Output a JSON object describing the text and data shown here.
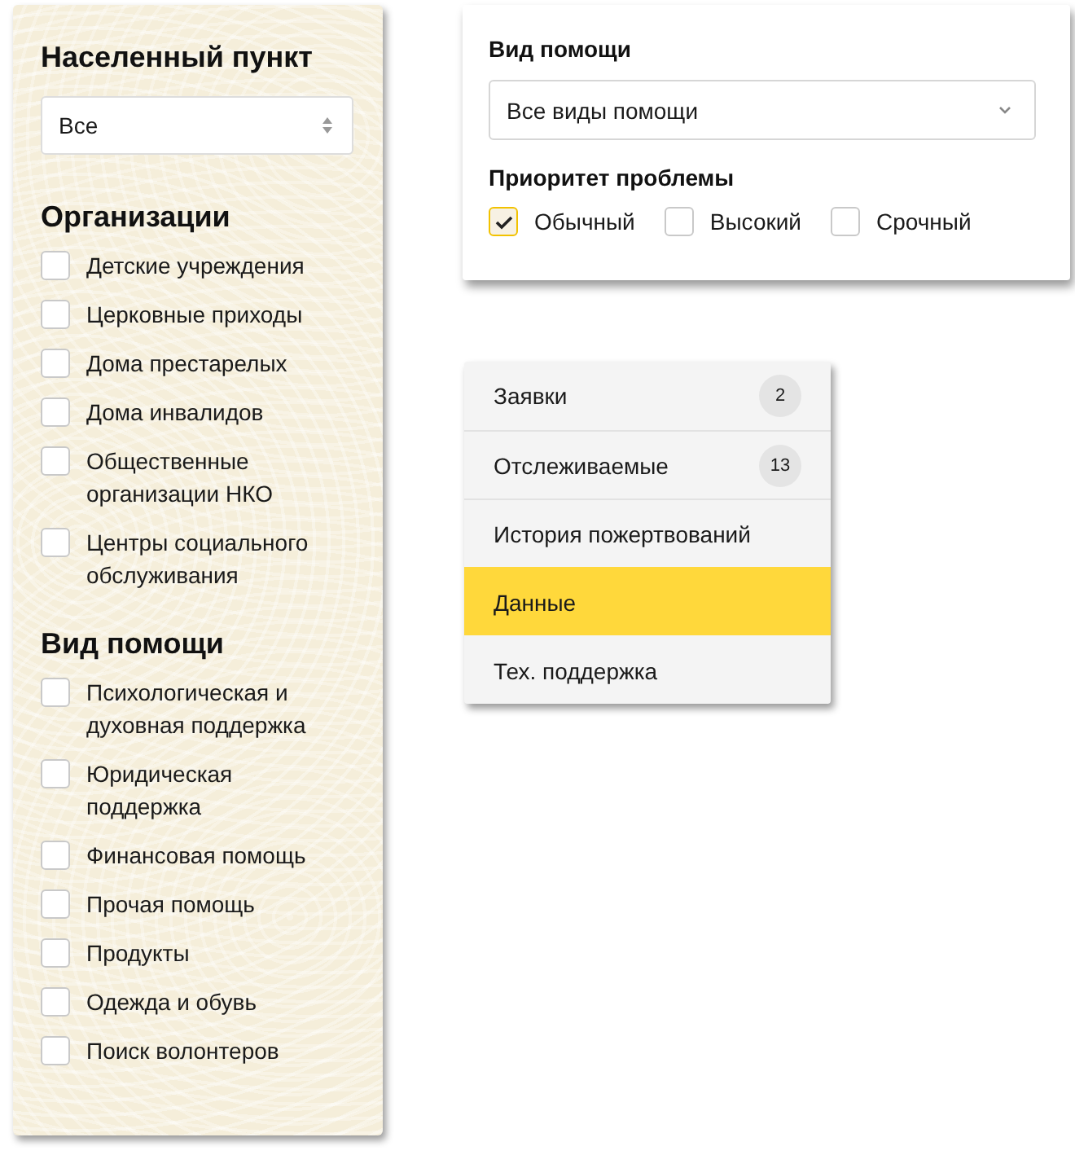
{
  "sidebar": {
    "locality": {
      "label": "Населенный пункт",
      "value": "Все"
    },
    "groups": [
      {
        "title": "Организации",
        "items": [
          {
            "label": "Детские учреждения",
            "checked": false
          },
          {
            "label": "Церковные приходы",
            "checked": false
          },
          {
            "label": "Дома престарелых",
            "checked": false
          },
          {
            "label": "Дома инвалидов",
            "checked": false
          },
          {
            "label": "Общественные организации НКО",
            "checked": false
          },
          {
            "label": "Центры социального обслуживания",
            "checked": false
          }
        ]
      },
      {
        "title": "Вид помощи",
        "items": [
          {
            "label": "Психологическая и духовная поддержка",
            "checked": false
          },
          {
            "label": "Юридическая поддержка",
            "checked": false
          },
          {
            "label": "Финансовая помощь",
            "checked": false
          },
          {
            "label": "Прочая помощь",
            "checked": false
          },
          {
            "label": "Продукты",
            "checked": false
          },
          {
            "label": "Одежда и обувь",
            "checked": false
          },
          {
            "label": "Поиск волонтеров",
            "checked": false
          }
        ]
      }
    ]
  },
  "filter_card": {
    "help_type": {
      "label": "Вид помощи",
      "value": "Все виды помощи"
    },
    "priority": {
      "label": "Приоритет проблемы",
      "options": [
        {
          "label": "Обычный",
          "checked": true
        },
        {
          "label": "Высокий",
          "checked": false
        },
        {
          "label": "Срочный",
          "checked": false
        }
      ]
    }
  },
  "menu": [
    {
      "label": "Заявки",
      "badge": "2",
      "selected": false
    },
    {
      "label": "Отслеживаемые",
      "badge": "13",
      "selected": false
    },
    {
      "label": "История пожертвований",
      "selected": false
    },
    {
      "label": "Данные",
      "selected": true
    },
    {
      "label": "Тех. поддержка",
      "selected": false
    }
  ]
}
